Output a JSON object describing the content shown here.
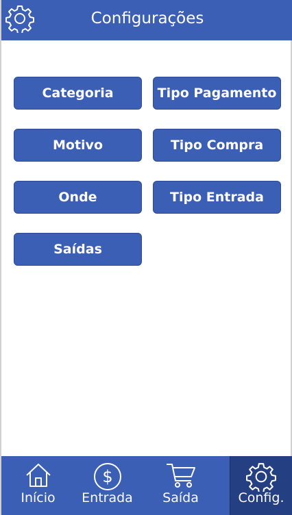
{
  "header": {
    "title": "Configurações",
    "icon": "gear-icon"
  },
  "buttons": {
    "categoria": "Categoria",
    "tipo_pagamento": "Tipo Pagamento",
    "motivo": "Motivo",
    "tipo_compra": "Tipo Compra",
    "onde": "Onde",
    "tipo_entrada": "Tipo Entrada",
    "saidas": "Saídas"
  },
  "bottom_nav": {
    "items": [
      {
        "label": "Início",
        "icon": "home-icon"
      },
      {
        "label": "Entrada",
        "icon": "dollar-circle-icon"
      },
      {
        "label": "Saída",
        "icon": "shopping-cart-icon"
      },
      {
        "label": "Config.",
        "icon": "gear-icon",
        "active": true
      }
    ]
  },
  "colors": {
    "primary": "#3a5fb5",
    "active_tab": "#243f82",
    "text": "#ffffff"
  }
}
